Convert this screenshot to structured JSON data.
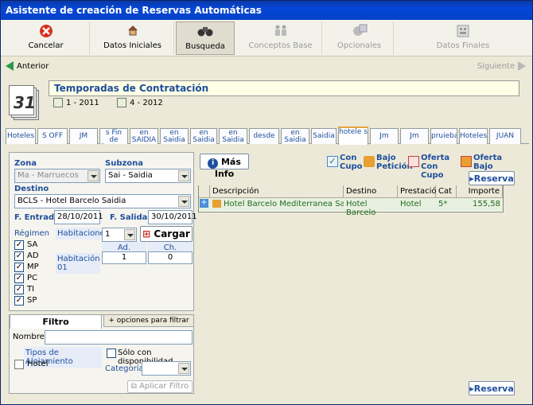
{
  "window": {
    "title": "Asistente de creación de Reservas Automáticas"
  },
  "toolbar": {
    "items": [
      {
        "label": "Cancelar",
        "icon": "cancel-icon"
      },
      {
        "label": "Datos Iniciales",
        "icon": "home-icon"
      },
      {
        "label": "Busqueda",
        "icon": "binoculars-icon"
      },
      {
        "label": "Conceptos Base",
        "icon": "people-icon"
      },
      {
        "label": "Opcionales",
        "icon": "options-icon"
      },
      {
        "label": "Datos Finales",
        "icon": "final-data-icon"
      }
    ]
  },
  "nav": {
    "prev": "Anterior",
    "next": "Siguiente"
  },
  "season": {
    "title": "Temporadas de Contratación",
    "calendar_day": "31",
    "options": [
      "1 - 2011",
      "4 - 2012"
    ]
  },
  "tabs": [
    "Hoteles",
    "S OFF …",
    "JM",
    "s Fin de Semana",
    "en SAIDIA",
    "en Saidia",
    "en Saidia",
    "en Saidia",
    "desde",
    "en Saidia",
    "Saidia",
    "hotele s",
    "Jm",
    "Jm",
    "pruiebas",
    "Hoteles",
    "JUAN"
  ],
  "search": {
    "zona_label": "Zona",
    "zona_value": "Ma - Marruecos",
    "subzona_label": "Subzona",
    "subzona_value": "Sai - Saidia",
    "destino_label": "Destino",
    "destino_value": "BCLS - Hotel Barcelo Saidia",
    "entrada_label": "F. Entrada",
    "entrada_value": "28/10/2011",
    "salida_label": "F. Salida",
    "salida_value": "30/10/2011",
    "regimen_label": "Régimen",
    "regimen": [
      {
        "code": "SA",
        "checked": true
      },
      {
        "code": "AD",
        "checked": true
      },
      {
        "code": "MP",
        "checked": true
      },
      {
        "code": "PC",
        "checked": true
      },
      {
        "code": "TI",
        "checked": true
      },
      {
        "code": "SP",
        "checked": true
      }
    ],
    "habitaciones_label": "Habitaciones",
    "habitaciones_value": "1",
    "cargar_label": "Cargar",
    "ad_label": "Ad.",
    "ch_label": "Ch.",
    "room_label": "Habitación 01",
    "room_ad": "1",
    "room_ch": "0"
  },
  "filter": {
    "tab_filtro": "Filtro",
    "tab_more": "+ opciones para filtrar",
    "nombre_label": "Nombre",
    "tipos_label": "Tipos de Alojamiento",
    "solo_label": "Sólo con disponibilidad",
    "hotel_label": "Hotel",
    "categoria_label": "Categoría",
    "aplicar_label": "Aplicar Filtro"
  },
  "results": {
    "mas_info": "Más Info",
    "legend": [
      "Con Cupo",
      "Bajo Petición",
      "Oferta Con Cupo",
      "Oferta Bajo Petición"
    ],
    "reserva_label": "Reserva",
    "headers": [
      "Descripción",
      "Destino",
      "Prestación",
      "Cat",
      "Importe"
    ],
    "rows": [
      {
        "descripcion": "Hotel Barcelo Mediterranea Saidia",
        "destino": "Hotel Barcelo",
        "prestacion": "Hotel",
        "cat": "5*",
        "importe": "155,58"
      }
    ]
  }
}
